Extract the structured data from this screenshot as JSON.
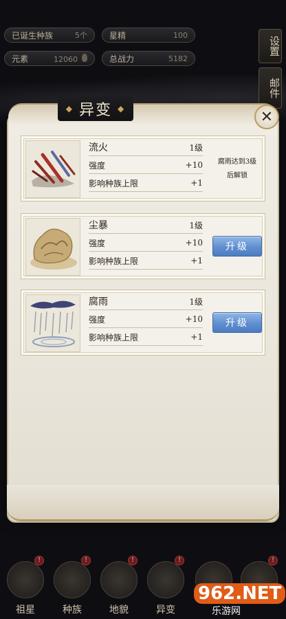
{
  "stats": [
    {
      "label": "已诞生种族",
      "value": "5个"
    },
    {
      "label": "星精",
      "value": "100"
    },
    {
      "label": "元素",
      "value": "12060"
    },
    {
      "label": "总战力",
      "value": "5182"
    }
  ],
  "side_buttons": {
    "settings": "设置",
    "mail": "邮件"
  },
  "panel": {
    "title": "异变"
  },
  "mutations": [
    {
      "name": "流火",
      "level": "1级",
      "stat1_label": "强度",
      "stat1_value": "+10",
      "stat2_label": "影响种族上限",
      "stat2_value": "+1",
      "lock_note_line1": "腐雨达到3级",
      "lock_note_line2": "后解锁"
    },
    {
      "name": "尘暴",
      "level": "1级",
      "stat1_label": "强度",
      "stat1_value": "+10",
      "stat2_label": "影响种族上限",
      "stat2_value": "+1",
      "action": "升级"
    },
    {
      "name": "腐雨",
      "level": "1级",
      "stat1_label": "强度",
      "stat1_value": "+10",
      "stat2_label": "影响种族上限",
      "stat2_value": "+1",
      "action": "升级"
    }
  ],
  "nav": [
    {
      "label": "祖星",
      "badge": "!"
    },
    {
      "label": "种族",
      "badge": "!"
    },
    {
      "label": "地貌",
      "badge": "!"
    },
    {
      "label": "异变",
      "badge": "!"
    },
    {
      "label": "",
      "badge": ""
    },
    {
      "label": "",
      "badge": "!"
    }
  ],
  "watermark": {
    "brand": "962.NET",
    "sub": "乐游网"
  },
  "colors": {
    "upgrade_button": "#5f8fd1",
    "panel": "#efece4",
    "accent_gold": "#c9a65b"
  }
}
